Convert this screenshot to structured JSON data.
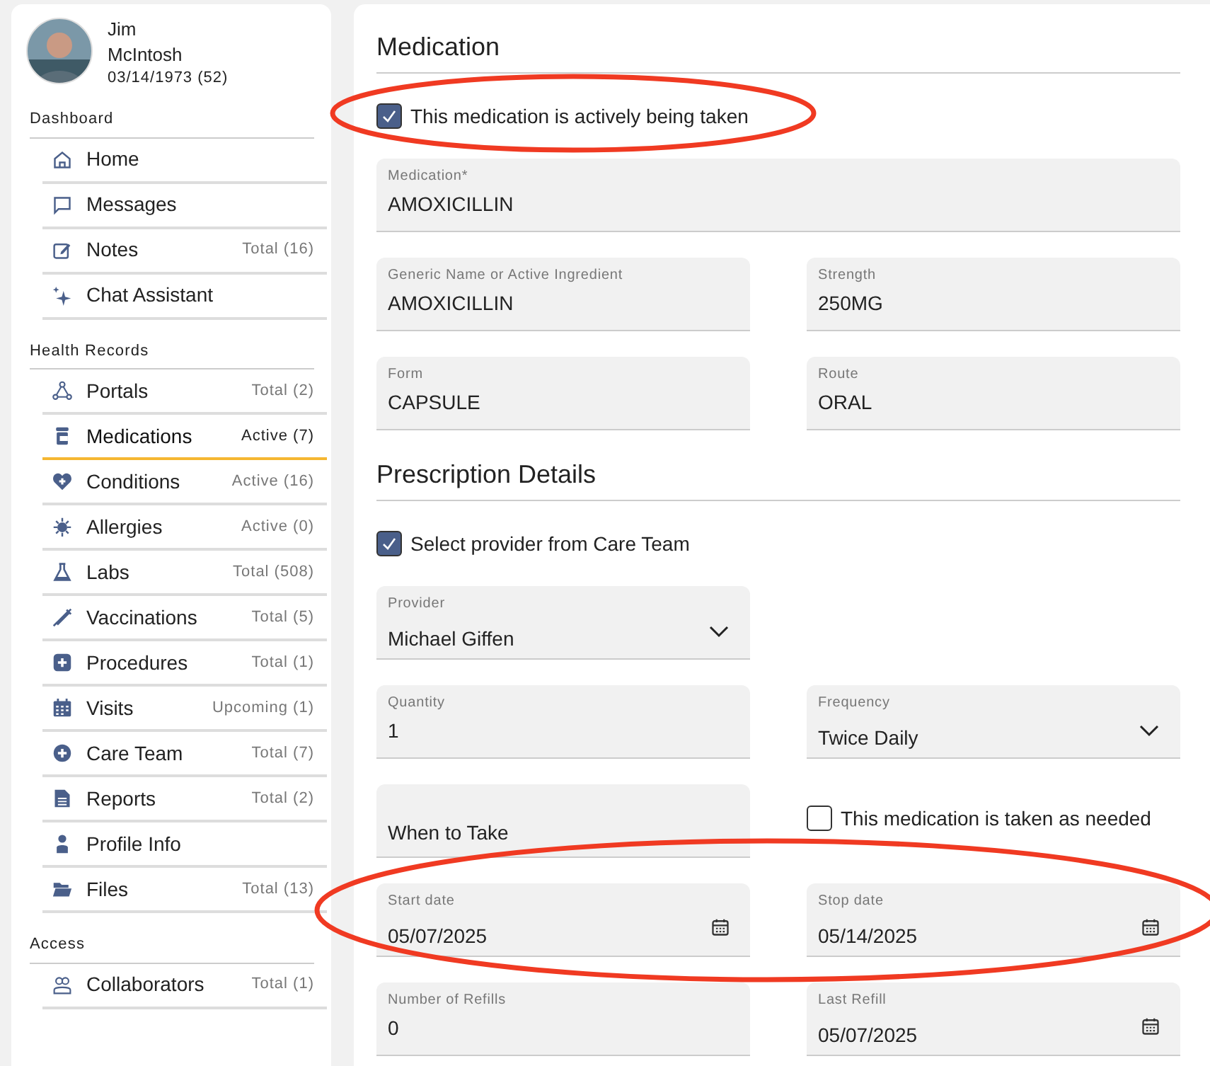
{
  "patient": {
    "first_name": "Jim",
    "last_name": "McIntosh",
    "birth": "03/14/1973 (52)"
  },
  "sidebar": [
    {
      "title": "Dashboard",
      "items": [
        {
          "label": "Home",
          "selected": false
        },
        {
          "label": "Messages",
          "selected": false
        },
        {
          "label": "Notes",
          "count": "Total (16)",
          "selected": false
        },
        {
          "label": "Chat Assistant",
          "selected": false
        }
      ]
    },
    {
      "title": "Health Records",
      "items": [
        {
          "label": "Portals",
          "count": "Total (2)",
          "selected": false
        },
        {
          "label": "Medications",
          "count": "Active (7)",
          "selected": true
        },
        {
          "label": "Conditions",
          "count": "Active (16)",
          "selected": false
        },
        {
          "label": "Allergies",
          "count": "Active (0)",
          "selected": false
        },
        {
          "label": "Labs",
          "count": "Total (508)",
          "selected": false
        },
        {
          "label": "Vaccinations",
          "count": "Total (5)",
          "selected": false
        },
        {
          "label": "Procedures",
          "count": "Total (1)",
          "selected": false
        },
        {
          "label": "Visits",
          "count": "Upcoming (1)",
          "selected": false
        },
        {
          "label": "Care Team",
          "count": "Total (7)",
          "selected": false
        },
        {
          "label": "Reports",
          "count": "Total (2)",
          "selected": false
        },
        {
          "label": "Profile Info",
          "selected": false
        },
        {
          "label": "Files",
          "count": "Total (13)",
          "selected": false
        }
      ]
    },
    {
      "title": "Access",
      "items": [
        {
          "label": "Collaborators",
          "count": "Total (1)",
          "selected": false
        }
      ]
    }
  ],
  "form": [
    {
      "kind": "heading",
      "text": "Medication"
    },
    {
      "kind": "checkbox",
      "label": "This medication is actively being taken",
      "checked": true
    },
    {
      "kind": "row",
      "cells": [
        {
          "kind": "input",
          "label": "Medication*",
          "value": "AMOXICILLIN",
          "wide": true
        }
      ]
    },
    {
      "kind": "row",
      "cells": [
        {
          "kind": "input",
          "label": "Generic Name or Active Ingredient",
          "value": "AMOXICILLIN"
        },
        {
          "kind": "input",
          "label": "Strength",
          "value": "250MG"
        }
      ]
    },
    {
      "kind": "row",
      "cells": [
        {
          "kind": "input",
          "label": "Form",
          "value": "CAPSULE"
        },
        {
          "kind": "input",
          "label": "Route",
          "value": "ORAL"
        }
      ]
    },
    {
      "kind": "heading",
      "text": "Prescription Details"
    },
    {
      "kind": "checkbox",
      "label": "Select provider from Care Team",
      "checked": true
    },
    {
      "kind": "row",
      "cells": [
        {
          "kind": "select",
          "label": "Provider",
          "value": "Michael Giffen"
        }
      ]
    },
    {
      "kind": "row",
      "cells": [
        {
          "kind": "input",
          "label": "Quantity",
          "value": "1"
        },
        {
          "kind": "select",
          "label": "Frequency",
          "value": "Twice Daily"
        }
      ]
    },
    {
      "kind": "row",
      "cells": [
        {
          "kind": "textarea",
          "placeholder": "When to Take"
        },
        {
          "kind": "checkbox",
          "label": "This medication is taken as needed",
          "checked": false
        }
      ]
    },
    {
      "kind": "row",
      "cells": [
        {
          "kind": "date",
          "label": "Start date",
          "value": "05/07/2025"
        },
        {
          "kind": "date",
          "label": "Stop date",
          "value": "05/14/2025"
        }
      ]
    },
    {
      "kind": "row",
      "cells": [
        {
          "kind": "input",
          "label": "Number of Refills",
          "value": "0"
        },
        {
          "kind": "date",
          "label": "Last Refill",
          "value": "05/07/2025"
        }
      ]
    }
  ],
  "annotations": [
    {
      "color": "#f03a22"
    },
    {
      "color": "#f03a22"
    }
  ]
}
